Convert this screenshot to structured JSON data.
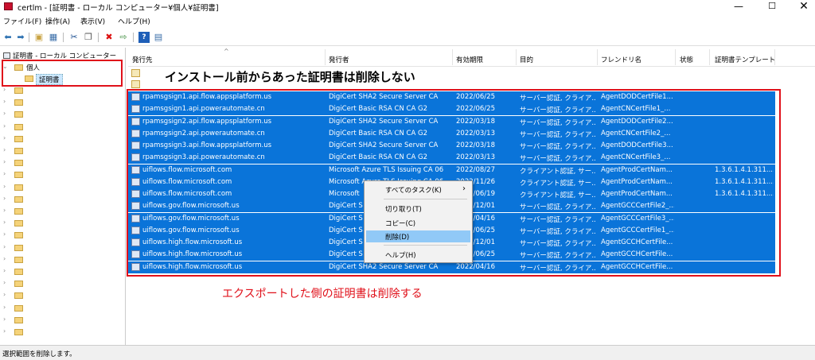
{
  "window": {
    "title": "certlm - [証明書 - ローカル コンピューター¥個人¥証明書]",
    "minimize": "—",
    "maximize": "☐",
    "close": "✕"
  },
  "menu": [
    "ファイル(F)",
    "操作(A)",
    "表示(V)",
    "ヘルプ(H)"
  ],
  "toolbar_icons": [
    "back-icon",
    "forward-icon",
    "folder-up-icon",
    "console-icon",
    "cut-icon",
    "copy-icon",
    "delete-icon",
    "export-icon",
    "help-icon",
    "properties-icon"
  ],
  "tree": {
    "root_label": "証明書 - ローカル コンピューター",
    "personal_label": "個人",
    "certs_label": "証明書"
  },
  "columns": [
    "発行先",
    "発行者",
    "有効期限",
    "目的",
    "フレンドリ名",
    "状態",
    "証明書テンプレート"
  ],
  "rows": [
    {
      "to": "rpamsgsign1.api.flow.appsplatform.us",
      "by": "DigiCert SHA2 Secure Server CA",
      "exp": "2022/06/25",
      "purpose": "サーバー認証, クライア...",
      "fname": "AgentDODCertFile1...",
      "tmpl": ""
    },
    {
      "to": "rpamsgsign1.api.powerautomate.cn",
      "by": "DigiCert Basic RSA CN CA G2",
      "exp": "2022/06/25",
      "purpose": "サーバー認証, クライア...",
      "fname": "AgentCNCertFile1_...",
      "tmpl": ""
    },
    {
      "to": "rpamsgsign2.api.flow.appsplatform.us",
      "by": "DigiCert SHA2 Secure Server CA",
      "exp": "2022/03/18",
      "purpose": "サーバー認証, クライア...",
      "fname": "AgentDODCertFile2...",
      "tmpl": ""
    },
    {
      "to": "rpamsgsign2.api.powerautomate.cn",
      "by": "DigiCert Basic RSA CN CA G2",
      "exp": "2022/03/13",
      "purpose": "サーバー認証, クライア...",
      "fname": "AgentCNCertFile2_...",
      "tmpl": ""
    },
    {
      "to": "rpamsgsign3.api.flow.appsplatform.us",
      "by": "DigiCert SHA2 Secure Server CA",
      "exp": "2022/03/18",
      "purpose": "サーバー認証, クライア...",
      "fname": "AgentDODCertFile3...",
      "tmpl": ""
    },
    {
      "to": "rpamsgsign3.api.powerautomate.cn",
      "by": "DigiCert Basic RSA CN CA G2",
      "exp": "2022/03/13",
      "purpose": "サーバー認証, クライア...",
      "fname": "AgentCNCertFile3_...",
      "tmpl": ""
    },
    {
      "to": "uiflows.flow.microsoft.com",
      "by": "Microsoft Azure TLS Issuing CA 06",
      "exp": "2022/08/27",
      "purpose": "クライアント認証, サー...",
      "fname": "AgentProdCertNam...",
      "tmpl": "1.3.6.1.4.1.311...."
    },
    {
      "to": "uiflows.flow.microsoft.com",
      "by": "Microsoft Azure TLS Issuing CA 06",
      "exp": "2022/11/26",
      "purpose": "クライアント認証, サー...",
      "fname": "AgentProdCertNam...",
      "tmpl": "1.3.6.1.4.1.311...."
    },
    {
      "to": "uiflows.flow.microsoft.com",
      "by": "Microsoft",
      "exp": "2022/06/19",
      "purpose": "クライアント認証, サー...",
      "fname": "AgentProdCertNam...",
      "tmpl": "1.3.6.1.4.1.311...."
    },
    {
      "to": "uiflows.gov.flow.microsoft.us",
      "by": "DigiCert S",
      "exp": "2022/12/01",
      "purpose": "サーバー認証, クライア...",
      "fname": "AgentGCCCertFile2_...",
      "tmpl": ""
    },
    {
      "to": "uiflows.gov.flow.microsoft.us",
      "by": "DigiCert S",
      "exp": "2022/04/16",
      "purpose": "サーバー認証, クライア...",
      "fname": "AgentGCCCertFile3_...",
      "tmpl": ""
    },
    {
      "to": "uiflows.gov.flow.microsoft.us",
      "by": "DigiCert S",
      "exp": "2022/06/25",
      "purpose": "サーバー認証, クライア...",
      "fname": "AgentGCCCertFile1_...",
      "tmpl": ""
    },
    {
      "to": "uiflows.high.flow.microsoft.us",
      "by": "DigiCert S",
      "exp": "2022/12/01",
      "purpose": "サーバー認証, クライア...",
      "fname": "AgentGCCHCertFile...",
      "tmpl": ""
    },
    {
      "to": "uiflows.high.flow.microsoft.us",
      "by": "DigiCert S",
      "exp": "2022/06/25",
      "purpose": "サーバー認証, クライア...",
      "fname": "AgentGCCHCertFile...",
      "tmpl": ""
    },
    {
      "to": "uiflows.high.flow.microsoft.us",
      "by": "DigiCert SHA2 Secure Server CA",
      "exp": "2022/04/16",
      "purpose": "サーバー認証, クライア...",
      "fname": "AgentGCCHCertFile...",
      "tmpl": ""
    }
  ],
  "context_menu": {
    "all_tasks": "すべてのタスク(K)",
    "cut": "切り取り(T)",
    "copy": "コピー(C)",
    "delete": "削除(D)",
    "help": "ヘルプ(H)"
  },
  "annotations": {
    "top": "インストール前からあった証明書は削除しない",
    "bottom": "エクスポートした側の証明書は削除する"
  },
  "status": "選択範囲を削除します。",
  "colors": {
    "selection": "#0a74d9",
    "annotation_red": "#e0101a",
    "menu_highlight": "#91c9f7"
  }
}
